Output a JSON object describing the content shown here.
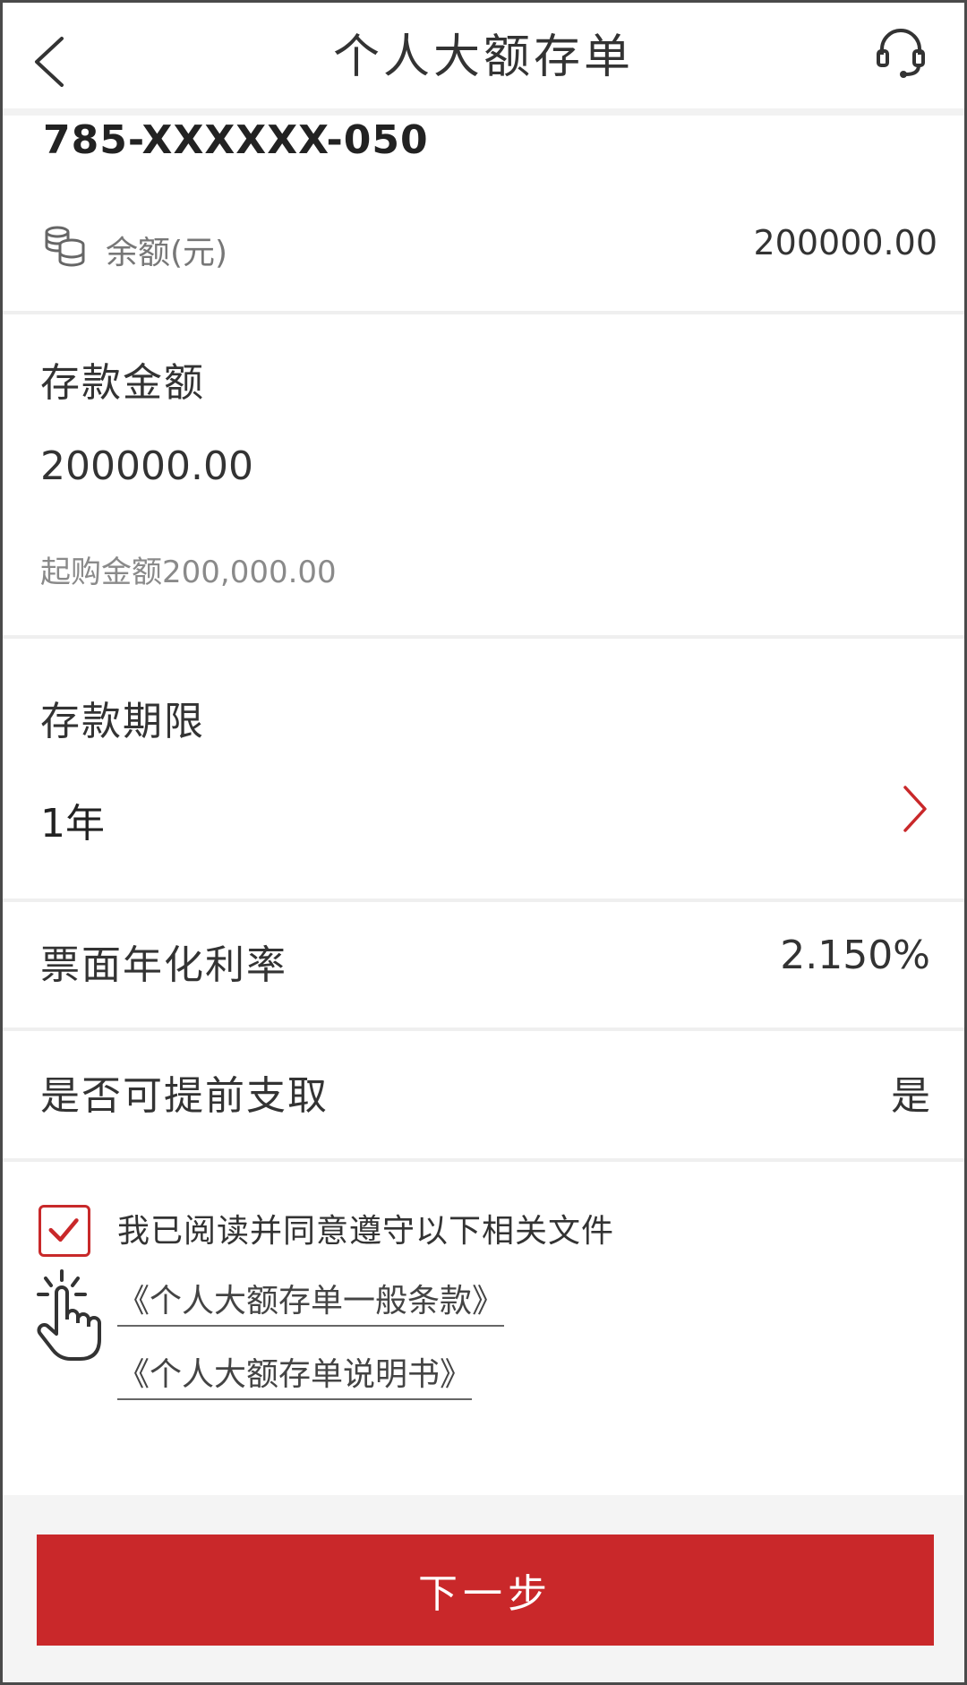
{
  "header": {
    "title": "个人大额存单"
  },
  "account": {
    "number": "785-XXXXXX-050",
    "balance_label": "余额(元)",
    "balance_value": "200000.00"
  },
  "deposit_amount": {
    "label": "存款金额",
    "value": "200000.00",
    "min_amount": "起购金额200,000.00"
  },
  "deposit_term": {
    "label": "存款期限",
    "value": "1年"
  },
  "rate": {
    "label": "票面年化利率",
    "value": "2.150%"
  },
  "early_withdrawal": {
    "label": "是否可提前支取",
    "value": "是"
  },
  "agreement": {
    "checked": true,
    "text": "我已阅读并同意遵守以下相关文件",
    "documents": [
      "《个人大额存单一般条款》",
      "《个人大额存单说明书》"
    ]
  },
  "footer": {
    "next_label": "下一步"
  },
  "colors": {
    "accent": "#c9282a",
    "divider": "#efefef",
    "footer_bg": "#f4f4f4"
  }
}
